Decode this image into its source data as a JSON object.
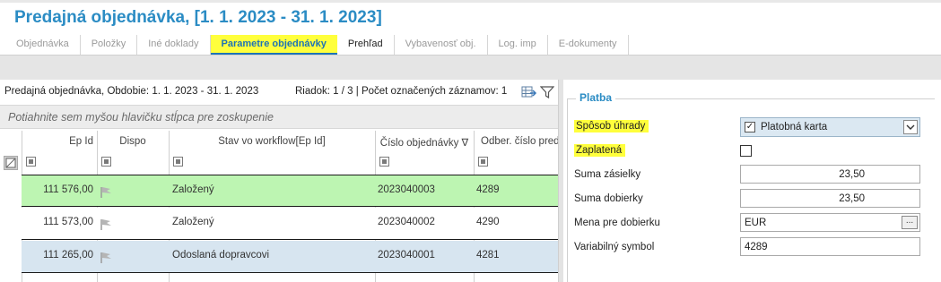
{
  "window": {
    "title": "Predajná objednávka,  [1. 1. 2023 - 31. 1. 2023]"
  },
  "tabs": [
    {
      "label": "Objednávka"
    },
    {
      "label": "Položky"
    },
    {
      "label": "Iné doklady"
    },
    {
      "label": "Parametre objednávky"
    },
    {
      "label": "Prehľad"
    },
    {
      "label": "Vybavenosť obj."
    },
    {
      "label": "Log. imp"
    },
    {
      "label": "E-dokumenty"
    }
  ],
  "active_tab": "Parametre objednávky",
  "current_tab": "Prehľad",
  "info_bar": {
    "left_text": "Predajná objednávka, Obdobie: 1. 1. 2023 - 31. 1. 2023",
    "right_text": "Riadok: 1 / 3 | Počet označených záznamov: 1",
    "export_icon": "grid-export-icon",
    "filter_icon": "funnel-filter-icon"
  },
  "group_bar": {
    "placeholder": "Potiahnite sem myšou hlavičku stĺpca pre zoskupenie"
  },
  "grid": {
    "columns": [
      "Ep Id",
      "Dispo",
      "Stav vo workflow[Ep Id]",
      "Číslo objednávky ∇",
      "Odber. číslo pred"
    ],
    "rows": [
      {
        "ep_id": "111 576,00",
        "stav": "Založený",
        "cislo": "2023040003",
        "odber": "4289"
      },
      {
        "ep_id": "111 573,00",
        "stav": "Založený",
        "cislo": "2023040002",
        "odber": "4290"
      },
      {
        "ep_id": "111 265,00",
        "stav": "Odoslaná dopravcovi",
        "cislo": "2023040001",
        "odber": "4281"
      }
    ],
    "row_colors": [
      "#bdf5b2",
      "#ffffff",
      "#d7e5f0"
    ],
    "dispo_icon": "flag-icon"
  },
  "platba": {
    "legend": "Platba",
    "sposob_uhrady_label": "Spôsob úhrady",
    "sposob_uhrady_value": "Platobná karta",
    "zaplatena_label": "Zaplatená",
    "zaplatena_checked": false,
    "suma_zasielky_label": "Suma zásielky",
    "suma_zasielky_value": "23,50",
    "suma_dobierky_label": "Suma dobierky",
    "suma_dobierky_value": "23,50",
    "mena_label": "Mena pre dobierku",
    "mena_value": "EUR",
    "mena_button": "...",
    "vs_label": "Variabilný symbol",
    "vs_value": "4289"
  },
  "colors": {
    "accent": "#2b8cc4",
    "highlight": "#ffff3c",
    "active_tab_text": "#1e73b5"
  }
}
